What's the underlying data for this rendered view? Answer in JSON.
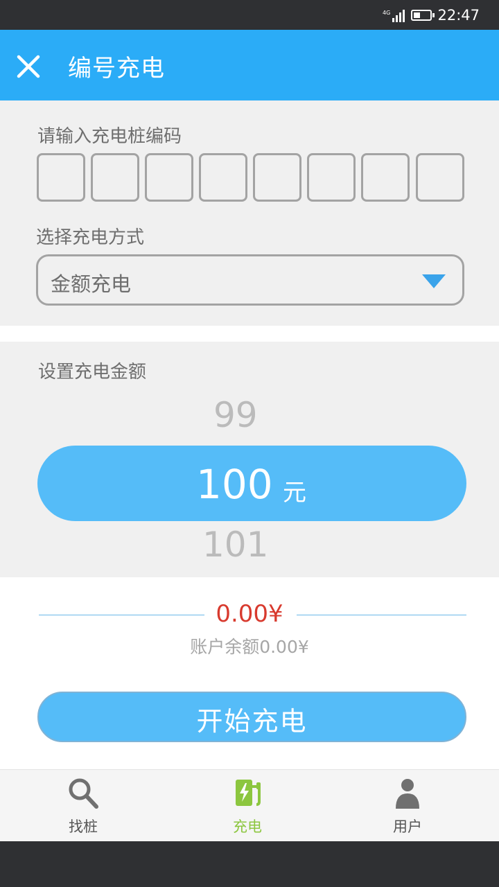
{
  "status_bar": {
    "network": "4G",
    "time": "22:47"
  },
  "app_bar": {
    "title": "编号充电",
    "close_icon": "close-icon"
  },
  "code_section": {
    "label": "请输入充电桩编码",
    "boxes": [
      "",
      "",
      "",
      "",
      "",
      "",
      "",
      ""
    ]
  },
  "mode_section": {
    "label": "选择充电方式",
    "selected": "金额充电",
    "dropdown_icon": "triangle-down-icon"
  },
  "amount_section": {
    "label": "设置充电金额",
    "prev": "99",
    "current": "100",
    "unit": "元",
    "next": "101"
  },
  "balance": {
    "amount": "0.00¥",
    "text": "账户余额0.00¥"
  },
  "start_button": "开始充电",
  "bottom_nav": [
    {
      "label": "找桩",
      "icon": "search-icon",
      "active": false
    },
    {
      "label": "充电",
      "icon": "charging-station-icon",
      "active": true
    },
    {
      "label": "用户",
      "icon": "user-icon",
      "active": false
    }
  ],
  "colors": {
    "primary": "#2bacf7",
    "button": "#55bcf8",
    "accent_active": "#8cc63f",
    "amount_red": "#d83a2e"
  }
}
